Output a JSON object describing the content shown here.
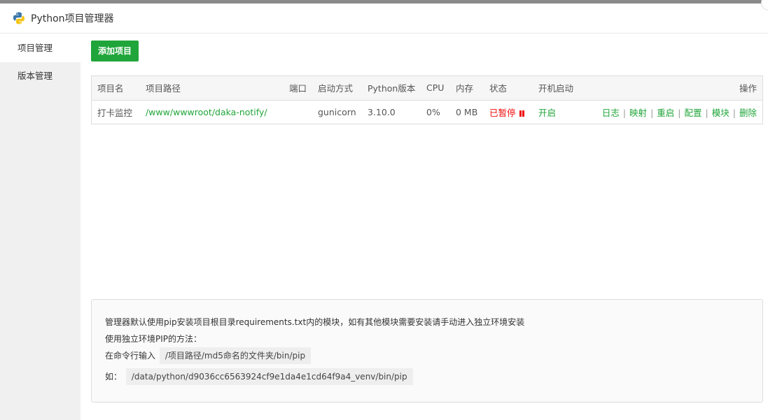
{
  "window": {
    "title": "Python项目管理器"
  },
  "sidebar": {
    "items": [
      {
        "label": "项目管理",
        "active": true
      },
      {
        "label": "版本管理",
        "active": false
      }
    ]
  },
  "toolbar": {
    "add_label": "添加项目"
  },
  "table": {
    "headers": [
      "项目名",
      "项目路径",
      "端口",
      "启动方式",
      "Python版本",
      "CPU",
      "内存",
      "状态",
      "开机启动",
      "操作"
    ],
    "rows": [
      {
        "name": "打卡监控",
        "path": "/www/wwwroot/daka-notify/",
        "port": "",
        "startup": "gunicorn",
        "python_version": "3.10.0",
        "cpu": "0%",
        "memory": "0 MB",
        "status": "已暂停",
        "autostart": "开启",
        "ops": [
          "日志",
          "映射",
          "重启",
          "配置",
          "模块",
          "删除"
        ]
      }
    ]
  },
  "note": {
    "line1": "管理器默认使用pip安装项目根目录requirements.txt内的模块，如有其他模块需要安装请手动进入独立环境安装",
    "line2": "使用独立环境PIP的方法：",
    "line3_label": "在命令行输入",
    "line3_code": "/项目路径/md5命名的文件夹/bin/pip",
    "line4_label": "如：",
    "line4_code": "/data/python/d9036cc6563924cf9e1da4e1cd64f9a4_venv/bin/pip"
  },
  "colors": {
    "accent": "#20a53a",
    "danger": "#ef0808"
  }
}
